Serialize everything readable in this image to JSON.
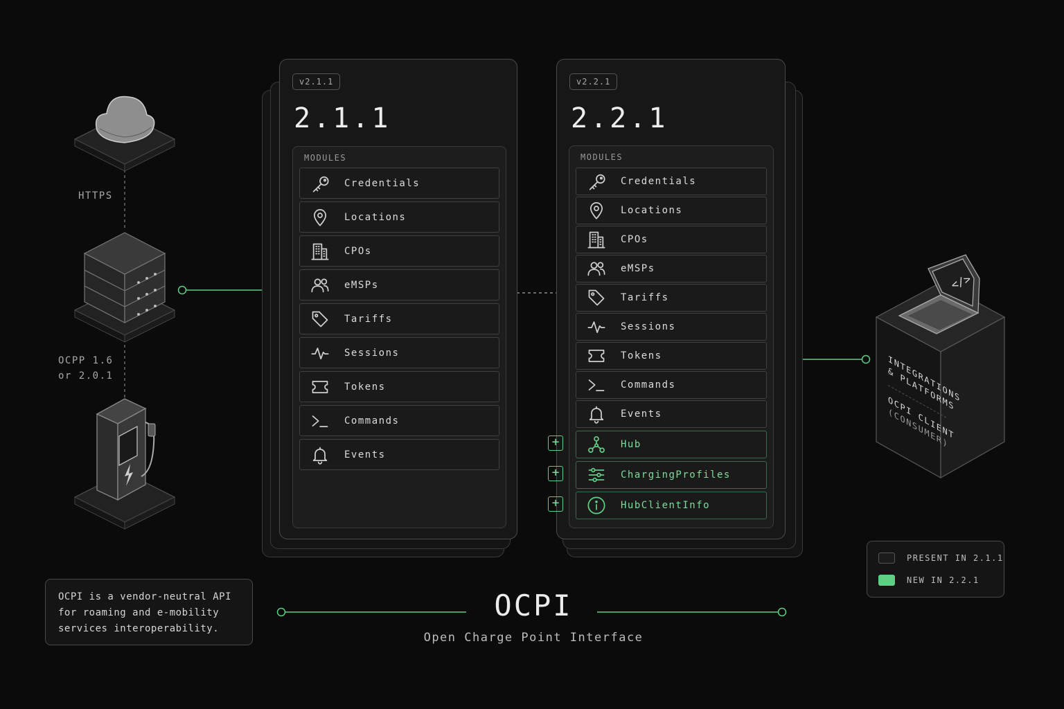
{
  "colors": {
    "accent": "#5fcf83",
    "background": "#0b0b0b",
    "panel": "#171717",
    "border": "#4a4a4a"
  },
  "labels": {
    "https": "HTTPS",
    "ocpp_line1": "OCPP 1.6",
    "ocpp_line2": "or 2.0.1"
  },
  "left_panel": {
    "badge": "v2.1.1",
    "title": "2.1.1",
    "modules_label": "MODULES",
    "modules": [
      {
        "label": "Credentials",
        "icon": "key-icon"
      },
      {
        "label": "Locations",
        "icon": "map-pin-icon"
      },
      {
        "label": "CPOs",
        "icon": "building-icon"
      },
      {
        "label": "eMSPs",
        "icon": "users-icon"
      },
      {
        "label": "Tariffs",
        "icon": "tag-icon"
      },
      {
        "label": "Sessions",
        "icon": "activity-icon"
      },
      {
        "label": "Tokens",
        "icon": "ticket-icon"
      },
      {
        "label": "Commands",
        "icon": "terminal-icon"
      },
      {
        "label": "Events",
        "icon": "bell-icon"
      }
    ]
  },
  "right_panel": {
    "badge": "v2.2.1",
    "title": "2.2.1",
    "modules_label": "MODULES",
    "modules": [
      {
        "label": "Credentials",
        "icon": "key-icon"
      },
      {
        "label": "Locations",
        "icon": "map-pin-icon"
      },
      {
        "label": "CPOs",
        "icon": "building-icon"
      },
      {
        "label": "eMSPs",
        "icon": "users-icon"
      },
      {
        "label": "Tariffs",
        "icon": "tag-icon"
      },
      {
        "label": "Sessions",
        "icon": "activity-icon"
      },
      {
        "label": "Tokens",
        "icon": "ticket-icon"
      },
      {
        "label": "Commands",
        "icon": "terminal-icon"
      },
      {
        "label": "Events",
        "icon": "bell-icon"
      },
      {
        "label": "Hub",
        "icon": "hub-icon",
        "new": true
      },
      {
        "label": "ChargingProfiles",
        "icon": "sliders-icon",
        "new": true
      },
      {
        "label": "HubClientInfo",
        "icon": "info-icon",
        "new": true
      }
    ]
  },
  "consumer_box": {
    "line1": "INTEGRATIONS",
    "line2": "& PLATFORMS",
    "line3": "OCPI CLIENT",
    "line4": "(CONSUMER)"
  },
  "info": {
    "line1": "OCPI is a vendor-neutral API",
    "line2": "for roaming and e-mobility",
    "line3": "services interoperability."
  },
  "legend": {
    "present": "PRESENT IN 2.1.1",
    "new": "NEW IN 2.2.1"
  },
  "footer": {
    "title": "OCPI",
    "subtitle": "Open Charge Point Interface"
  }
}
